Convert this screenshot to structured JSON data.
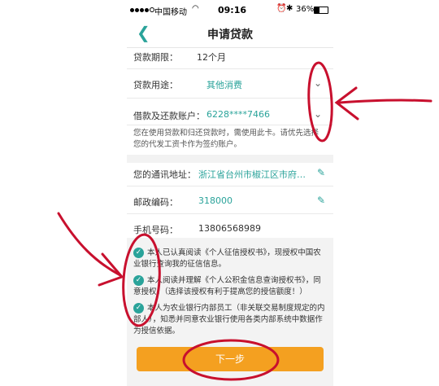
{
  "status_bar": {
    "carrier": "中国移动",
    "time": "09:16",
    "battery": "36%",
    "battery_level": 0.36
  },
  "nav": {
    "title": "申请贷款"
  },
  "form": {
    "term": {
      "label": "贷款期限：",
      "value": "12个月"
    },
    "purpose": {
      "label": "贷款用途：",
      "value": "其他消费"
    },
    "account": {
      "label": "借款及还款账户：",
      "value": "6228****7466"
    },
    "account_note": "您在使用贷款和归还贷款时，需使用此卡。请优先选择您的代发工资卡作为签约账户。",
    "address": {
      "label": "您的通讯地址：",
      "value": "浙江省台州市椒江区市府…"
    },
    "postcode": {
      "label": "邮政编码：",
      "value": "318000"
    },
    "phone": {
      "label": "手机号码：",
      "value": "13806568989"
    }
  },
  "agreements": [
    {
      "text": "本人已认真阅读《个人征信授权书》，现授权中国农业银行查询我的征信信息。"
    },
    {
      "text": "本人阅读并理解《个人公积金信息查询授权书》，同意授权。（选择该授权有利于提高您的授信额度！）"
    },
    {
      "text": "本人为农业银行内部员工（非关联交易制度规定的内部人），知悉并同意农业银行使用各类内部系统中数据作为授信依据。"
    }
  ],
  "next_button": "下一步",
  "colors": {
    "accent": "#2aa39a",
    "button": "#f4a020",
    "annotation": "#c8102e"
  },
  "icons": {
    "back": "chevron-left-icon",
    "dropdown": "chevron-down-icon",
    "edit": "pencil-icon",
    "check": "check-circle-icon"
  }
}
